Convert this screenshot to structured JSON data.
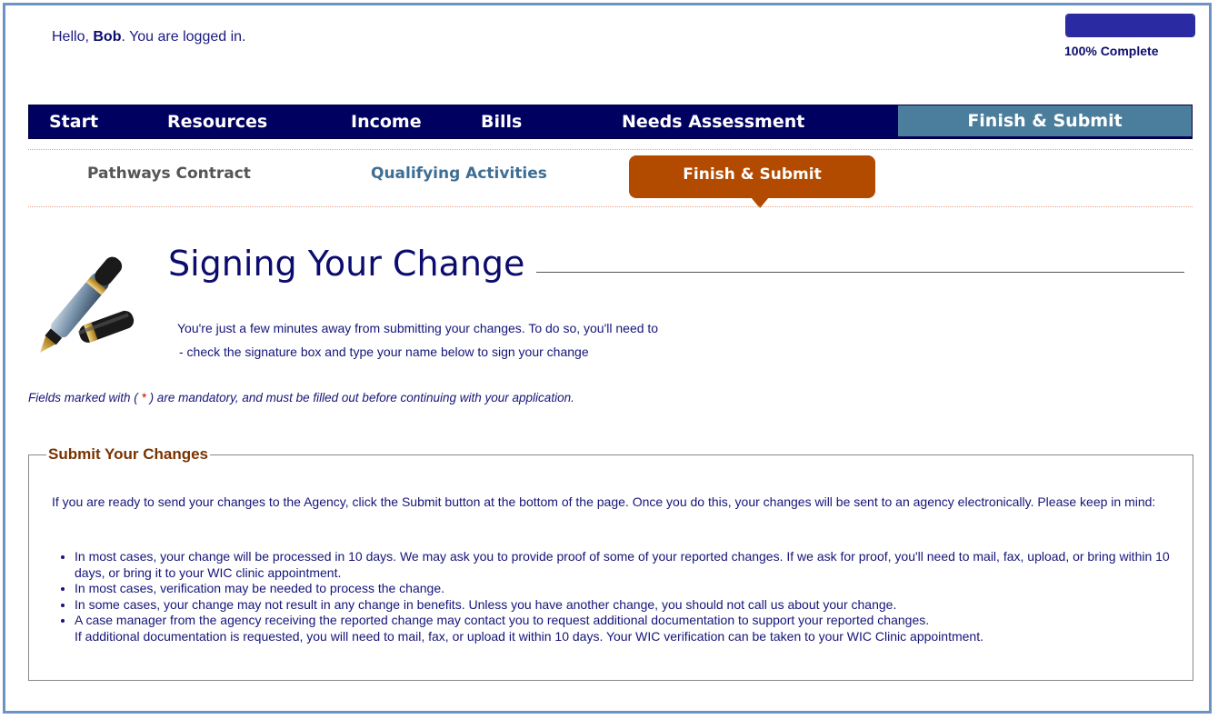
{
  "header": {
    "greeting_prefix": "Hello, ",
    "user_name": "Bob",
    "greeting_suffix": ". You are logged in.",
    "progress_percent": 100,
    "progress_label": "100% Complete"
  },
  "topnav": {
    "tabs": [
      {
        "label": "Start"
      },
      {
        "label": "Resources"
      },
      {
        "label": "Income"
      },
      {
        "label": "Bills"
      },
      {
        "label": "Needs Assessment"
      },
      {
        "label": "Finish & Submit",
        "active": true
      }
    ]
  },
  "subnav": {
    "tabs": [
      {
        "label": "Pathways Contract"
      },
      {
        "label": "Qualifying Activities"
      },
      {
        "label": "Finish & Submit",
        "active": true
      }
    ]
  },
  "page": {
    "icon": "fountain-pen-icon",
    "title": "Signing Your Change",
    "intro_line1": "You're just a few minutes away from submitting your changes. To do so, you'll need to",
    "intro_line2": "- check the signature box and type your name below to sign your change",
    "mandatory_prefix": "Fields marked with ( ",
    "mandatory_star": "*",
    "mandatory_suffix": " ) are mandatory, and must be filled out before continuing with your application."
  },
  "submit_section": {
    "legend": "Submit Your Changes",
    "paragraph": "If you are ready to send your changes to the Agency, click the Submit button at the bottom of the page. Once you do this, your changes will be sent to an agency electronically. Please keep in mind:",
    "bullets": [
      "In most cases, your change will be processed in 10 days. We may ask you to provide proof of some of your reported changes. If we ask for proof, you'll need to mail, fax, upload, or bring within 10 days, or bring it to your WIC clinic appointment.",
      "In most cases, verification may be needed to process the change.",
      "In some cases, your change may not result in any change in benefits. Unless you have another change, you should not call us about your change.",
      "A case manager from the agency receiving the reported change may contact you to request additional documentation to support your reported changes."
    ],
    "bullet4_continuation": "If additional documentation is requested, you will need to mail, fax, or upload it within 10 days. Your WIC verification can be taken to your WIC Clinic appointment."
  },
  "colors": {
    "nav_bg": "#000060",
    "active_tab": "#4b7d9c",
    "accent_orange": "#b24a00",
    "text_navy": "#15157a"
  }
}
